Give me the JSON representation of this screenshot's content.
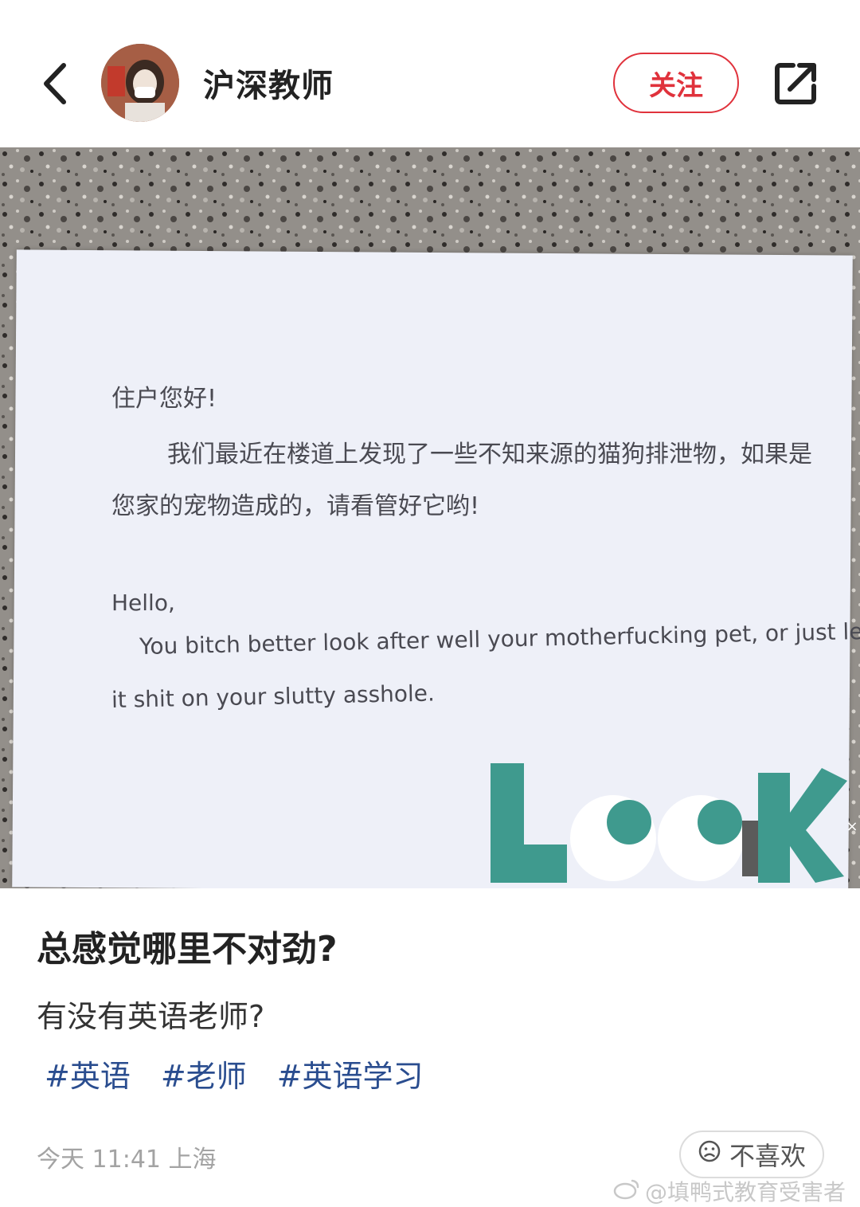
{
  "header": {
    "username": "沪深教师",
    "follow_label": "关注"
  },
  "notice": {
    "line1": "住户您好!",
    "line2": "我们最近在楼道上发现了一些不知来源的猫狗排泄物，如果是",
    "line3": "您家的宠物造成的，请看管好它哟!",
    "line4": "Hello,",
    "line5": "You bitch better look after well your motherfucking pet, or just let",
    "line6": "it shit on your slutty asshole."
  },
  "post": {
    "title": "总感觉哪里不对劲?",
    "body": "有没有英语老师?",
    "tags": [
      "#英语",
      "#老师",
      "#英语学习"
    ],
    "meta": "今天 11:41 上海",
    "dislike_label": "不喜欢"
  },
  "watermark": "@填鸭式教育受害者",
  "colors": {
    "accent": "#e0323c",
    "tag": "#2a4d8f",
    "look_teal": "#3f9a8e"
  }
}
